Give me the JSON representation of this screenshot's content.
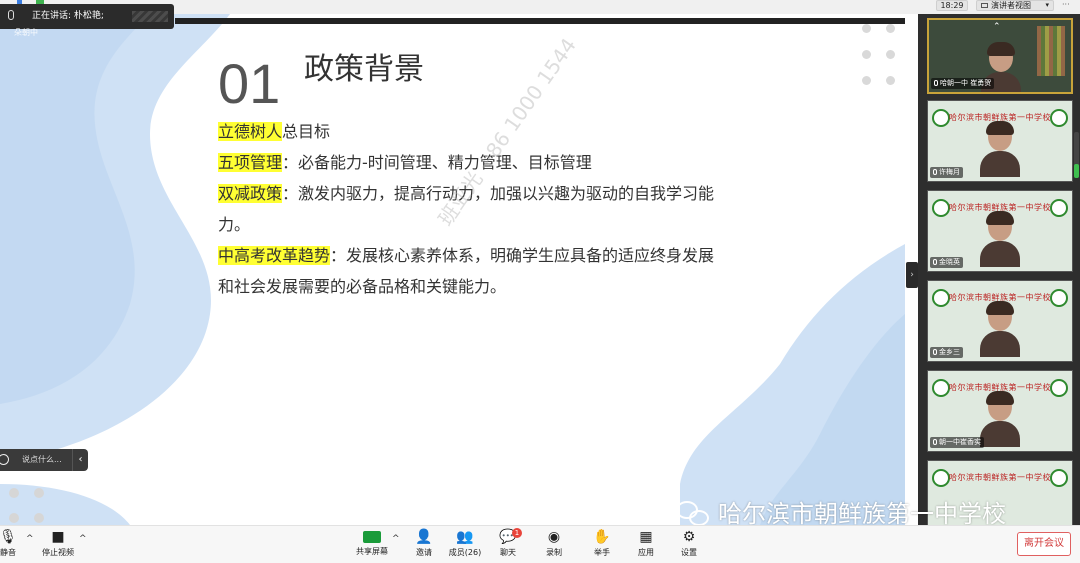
{
  "topbar": {
    "clock": "18:29",
    "view_label": "演讲者视图",
    "more": "···"
  },
  "speaking": {
    "text": "正在讲话: 朴松艳;",
    "sub": "朵朝中"
  },
  "slide": {
    "number": "01",
    "title": "政策背景",
    "items": [
      {
        "highlight": "立德树人",
        "text": "总目标"
      },
      {
        "highlight": "五项管理",
        "text": "：必备能力-时间管理、精力管理、目标管理"
      },
      {
        "highlight": "双减政策",
        "text": "：激发内驱力，提高行动力，加强以兴趣为驱动的自我学习能力。"
      },
      {
        "highlight": "中高考改革趋势",
        "text": "：发展核心素养体系，明确学生应具备的适应终身发展和社会发展需要的必备品格和关键能力。"
      }
    ],
    "watermark": "班亚光 +86 1000 1544",
    "colors": {
      "highlight": "#ffff33",
      "blob": "#cfe1f5"
    }
  },
  "chat": {
    "placeholder": "说点什么..."
  },
  "participants": [
    {
      "name": "哈朝一中 崔勇贺",
      "banner": ""
    },
    {
      "name": "许梅月",
      "banner": "哈尔滨市朝鲜族第一中学校"
    },
    {
      "name": "金晓英",
      "banner": "哈尔滨市朝鲜族第一中学校"
    },
    {
      "name": "金乡三",
      "banner": "哈尔滨市朝鲜族第一中学校"
    },
    {
      "name": "朝一中崔香实",
      "banner": "哈尔滨市朝鲜族第一中学校"
    },
    {
      "name": "",
      "banner": "哈尔滨市朝鲜族第一中学校"
    }
  ],
  "toolbar": {
    "mute": "静音",
    "stop_video": "停止视频",
    "share": "共享屏幕",
    "invite": "邀请",
    "members": "成员(26)",
    "chat": "聊天",
    "chat_badge": "1",
    "record": "录制",
    "raise_hand": "举手",
    "apps": "应用",
    "settings": "设置",
    "leave": "离开会议"
  },
  "school_watermark": "哈尔滨市朝鲜族第一中学校"
}
